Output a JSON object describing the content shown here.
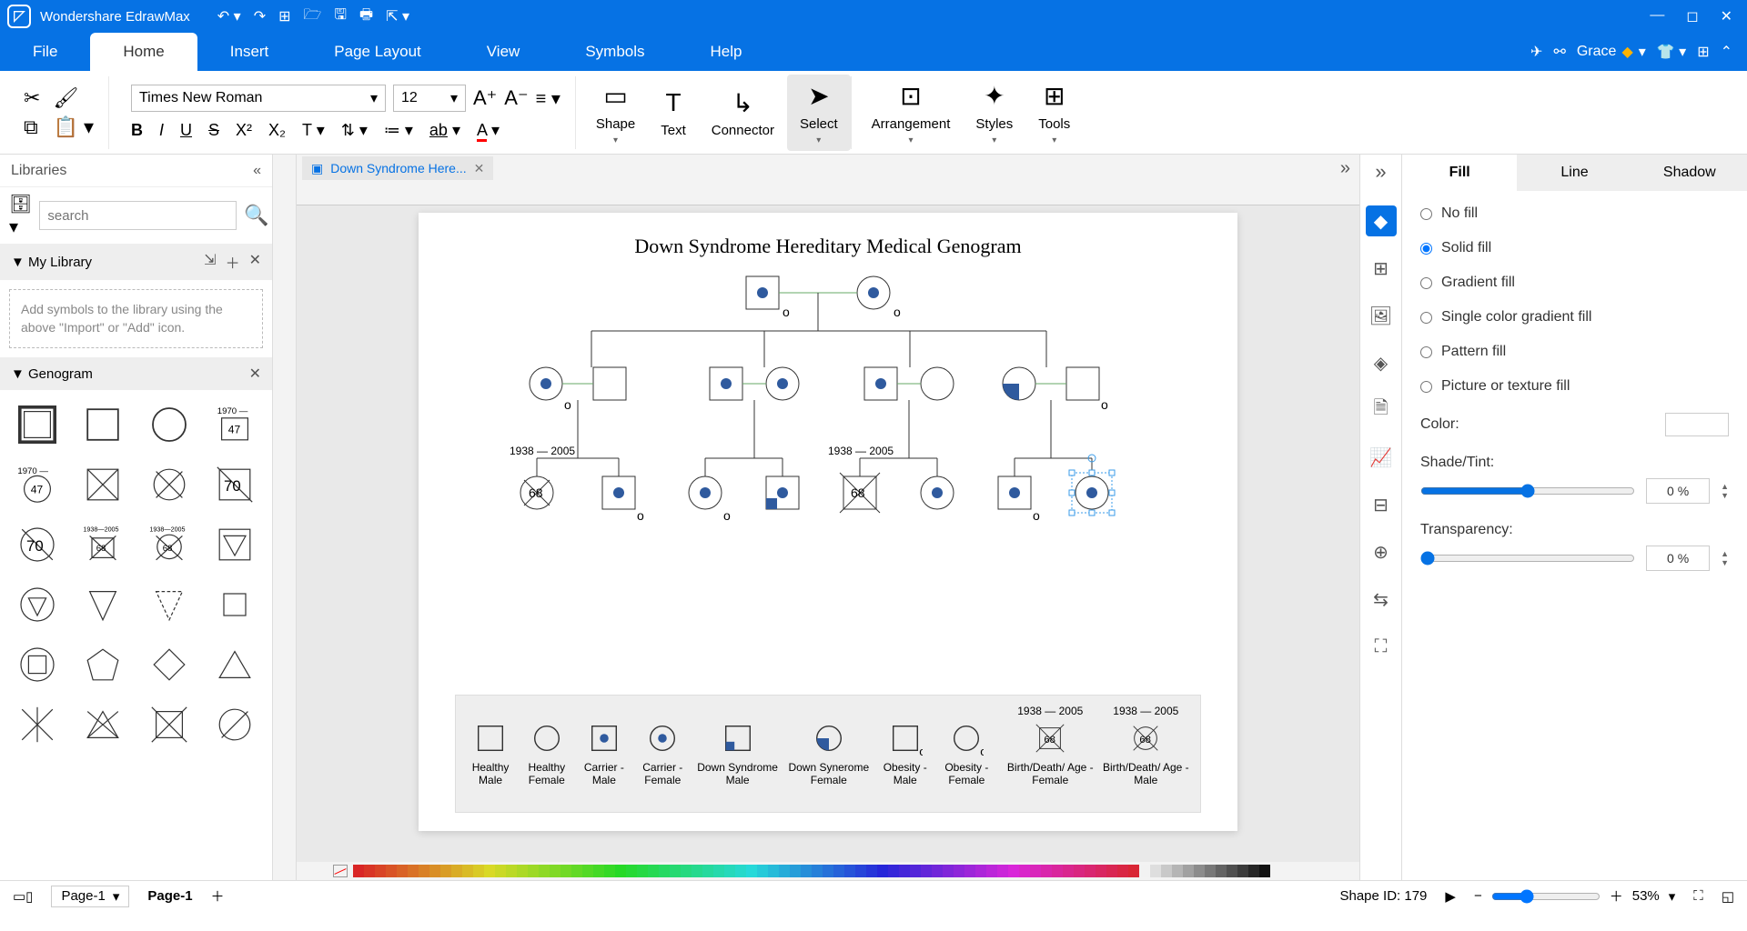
{
  "app": {
    "name": "Wondershare EdrawMax"
  },
  "user": {
    "name": "Grace"
  },
  "menu": {
    "file": "File",
    "home": "Home",
    "insert": "Insert",
    "page_layout": "Page Layout",
    "view": "View",
    "symbols": "Symbols",
    "help": "Help"
  },
  "ribbon": {
    "font_name": "Times New Roman",
    "font_size": "12",
    "shape": "Shape",
    "text": "Text",
    "connector": "Connector",
    "select": "Select",
    "arrangement": "Arrangement",
    "styles": "Styles",
    "tools": "Tools"
  },
  "libraries": {
    "title": "Libraries",
    "search_placeholder": "search",
    "my_library": "My Library",
    "tip": "Add symbols to the library using the above \"Import\" or \"Add\" icon.",
    "genogram": "Genogram"
  },
  "doc_tab": "Down Syndrome Here...",
  "diagram": {
    "title": "Down Syndrome Hereditary Medical Genogram"
  },
  "legend": {
    "items": [
      "Healthy Male",
      "Healthy Female",
      "Carrier - Male",
      "Carrier - Female",
      "Down Syndrome Male",
      "Down Synerome Female",
      "Obesity - Male",
      "Obesity - Female",
      "Birth/Death/ Age - Female",
      "Birth/Death/ Age - Male"
    ],
    "year_a": "1938 — 2005",
    "year_b": "1938 — 2005",
    "age_a": "68",
    "age_b": "68"
  },
  "geno_labels": {
    "year1": "1938 — 2005",
    "age1": "68",
    "year2": "1938 — 2005",
    "age2": "68",
    "year1b": "1970 —",
    "age1b": "47",
    "year2b": "1970 —",
    "age2b": "47",
    "age70": "70"
  },
  "props": {
    "tabs": {
      "fill": "Fill",
      "line": "Line",
      "shadow": "Shadow"
    },
    "no_fill": "No fill",
    "solid_fill": "Solid fill",
    "gradient_fill": "Gradient fill",
    "single_gradient": "Single color gradient fill",
    "pattern_fill": "Pattern fill",
    "picture_fill": "Picture or texture fill",
    "color": "Color:",
    "shade": "Shade/Tint:",
    "transparency": "Transparency:",
    "pct": "0 %"
  },
  "status": {
    "page_select": "Page-1",
    "page_tab": "Page-1",
    "shape_id_label": "Shape ID:",
    "shape_id": "179",
    "zoom": "53%"
  }
}
